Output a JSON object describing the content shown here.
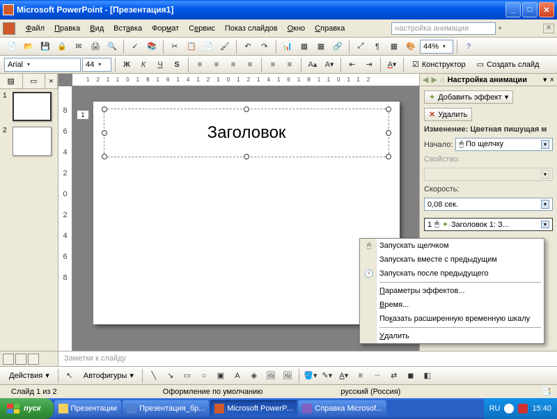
{
  "titlebar": {
    "text": "Microsoft PowerPoint - [Презентация1]"
  },
  "menu": {
    "file": "Файл",
    "edit": "Правка",
    "view": "Вид",
    "insert": "Вставка",
    "format": "Формат",
    "tools": "Сервис",
    "slideshow": "Показ слайдов",
    "window": "Окно",
    "help": "Справка",
    "helpbox": "настройка анимации"
  },
  "format_tb": {
    "font": "Arial",
    "size": "44",
    "designer": "Конструктор",
    "new_slide": "Создать слайд"
  },
  "zoom": "44%",
  "ruler_h": "12 10 8 6 4 2 0 2 4 6 8 10 12",
  "ruler_v": [
    "8",
    "6",
    "4",
    "2",
    "0",
    "2",
    "4",
    "6",
    "8"
  ],
  "thumbs": {
    "n1": "1",
    "n2": "2"
  },
  "slide": {
    "title": "Заголовок",
    "tag": "1"
  },
  "anim_pane": {
    "title": "Настройка анимации",
    "add_effect": "Добавить эффект",
    "delete": "Удалить",
    "change_label": "Изменение: Цветная пишущая м",
    "start_label": "Начало:",
    "start_value": "По щелчку",
    "property_label": "Свойство:",
    "speed_label": "Скорость:",
    "speed_value": "0,08 сек.",
    "item_num": "1",
    "item_text": "Заголовок 1: З..."
  },
  "context_menu": {
    "on_click": "Запускать щелчком",
    "with_prev": "Запускать вместе с предыдущим",
    "after_prev": "Запускать после предыдущего",
    "effect_opts": "Параметры эффектов...",
    "timing": "Время...",
    "show_timeline": "Показать расширенную временную шкалу",
    "remove": "Удалить"
  },
  "notes": "Заметки к слайду",
  "bottom_tb": {
    "actions": "Действия",
    "autoshapes": "Автофигуры"
  },
  "status": {
    "slide": "Слайд 1 из 2",
    "design": "Оформление по умолчанию",
    "lang": "русский (Россия)"
  },
  "taskbar": {
    "start": "пуск",
    "t1": "Презентации",
    "t2": "Презентация_бр...",
    "t3": "Microsoft PowerP...",
    "t4": "Справка Microsof...",
    "lang": "RU",
    "time": "15:40"
  }
}
